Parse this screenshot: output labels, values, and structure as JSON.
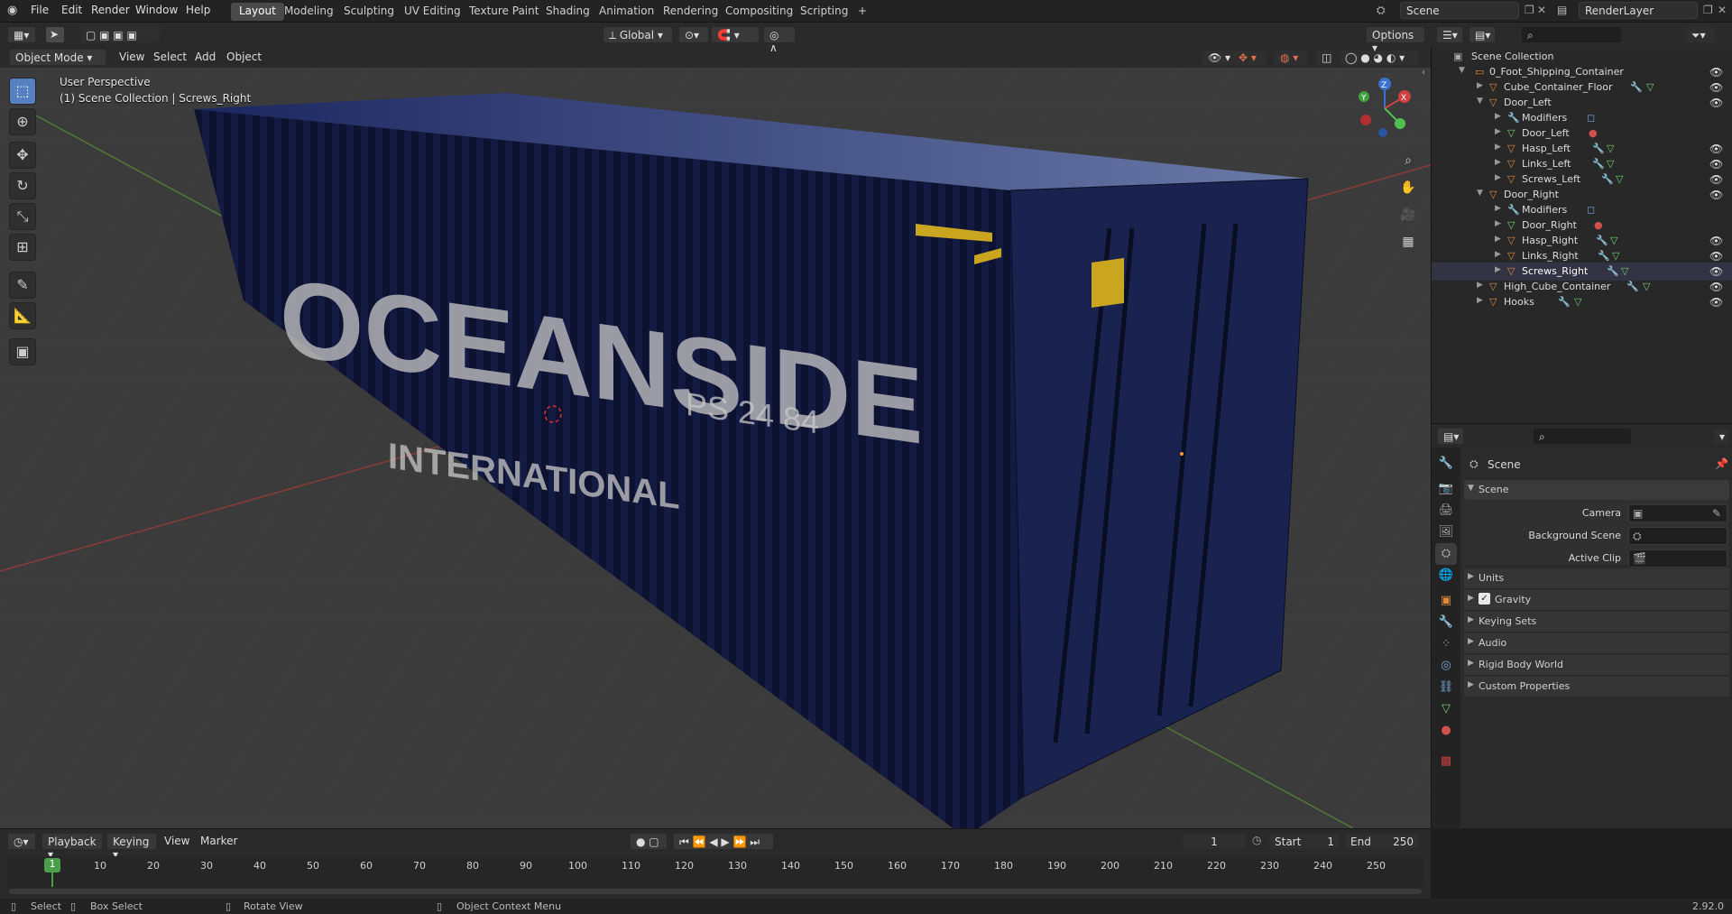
{
  "topbar": {
    "menus": [
      "File",
      "Edit",
      "Render",
      "Window",
      "Help"
    ],
    "workspaces": [
      "Layout",
      "Modeling",
      "Sculpting",
      "UV Editing",
      "Texture Paint",
      "Shading",
      "Animation",
      "Rendering",
      "Compositing",
      "Scripting"
    ],
    "active_workspace": "Layout",
    "add_tab": "+",
    "scene": "Scene",
    "view_layer": "RenderLayer"
  },
  "viewport_header": {
    "mode": "Object Mode",
    "menus": [
      "View",
      "Select",
      "Add",
      "Object"
    ],
    "orientation": "Global",
    "options": "Options"
  },
  "viewport": {
    "perspective": "User Perspective",
    "collection_info": "(1) Scene Collection | Screws_Right",
    "container_text": "OCEANSIDE",
    "container_sub": "INTERNATIONAL",
    "container_code": "PS 24 84",
    "gizmo_axes": [
      "X",
      "Y",
      "Z"
    ]
  },
  "outliner": {
    "root": "Scene Collection",
    "items": [
      {
        "label": "0_Foot_Shipping_Container",
        "type": "collection",
        "eye": true
      },
      {
        "label": "Cube_Container_Floor",
        "type": "object",
        "eye": true
      },
      {
        "label": "Door_Left",
        "type": "object",
        "eye": true
      },
      {
        "label": "Modifiers",
        "type": "modifiers",
        "eye": false
      },
      {
        "label": "Door_Left",
        "type": "mesh",
        "eye": false
      },
      {
        "label": "Hasp_Left",
        "type": "object",
        "eye": true
      },
      {
        "label": "Links_Left",
        "type": "object",
        "eye": true
      },
      {
        "label": "Screws_Left",
        "type": "object",
        "eye": true
      },
      {
        "label": "Door_Right",
        "type": "object",
        "eye": true
      },
      {
        "label": "Modifiers",
        "type": "modifiers",
        "eye": false
      },
      {
        "label": "Door_Right",
        "type": "mesh",
        "eye": false
      },
      {
        "label": "Hasp_Right",
        "type": "object",
        "eye": true
      },
      {
        "label": "Links_Right",
        "type": "object",
        "eye": true
      },
      {
        "label": "Screws_Right",
        "type": "object",
        "eye": true
      },
      {
        "label": "High_Cube_Container",
        "type": "object",
        "eye": true
      },
      {
        "label": "Hooks",
        "type": "object",
        "eye": true
      }
    ]
  },
  "properties": {
    "header": "Scene",
    "panel": "Scene",
    "fields": {
      "camera": "Camera",
      "background_scene": "Background Scene",
      "active_clip": "Active Clip"
    },
    "sections": [
      "Units",
      "Gravity",
      "Keying Sets",
      "Audio",
      "Rigid Body World",
      "Custom Properties"
    ],
    "gravity_checked": true
  },
  "timeline": {
    "menus": [
      "Playback",
      "Keying",
      "View",
      "Marker"
    ],
    "current_frame": "1",
    "start_label": "Start",
    "start": "1",
    "end_label": "End",
    "end": "250",
    "ticks": [
      "1",
      "10",
      "20",
      "30",
      "40",
      "50",
      "60",
      "70",
      "80",
      "90",
      "100",
      "110",
      "120",
      "130",
      "140",
      "150",
      "160",
      "170",
      "180",
      "190",
      "200",
      "210",
      "220",
      "230",
      "240",
      "250"
    ]
  },
  "statusbar": {
    "select": "Select",
    "box_select": "Box Select",
    "rotate_view": "Rotate View",
    "context_menu": "Object Context Menu",
    "version": "2.92.0"
  }
}
